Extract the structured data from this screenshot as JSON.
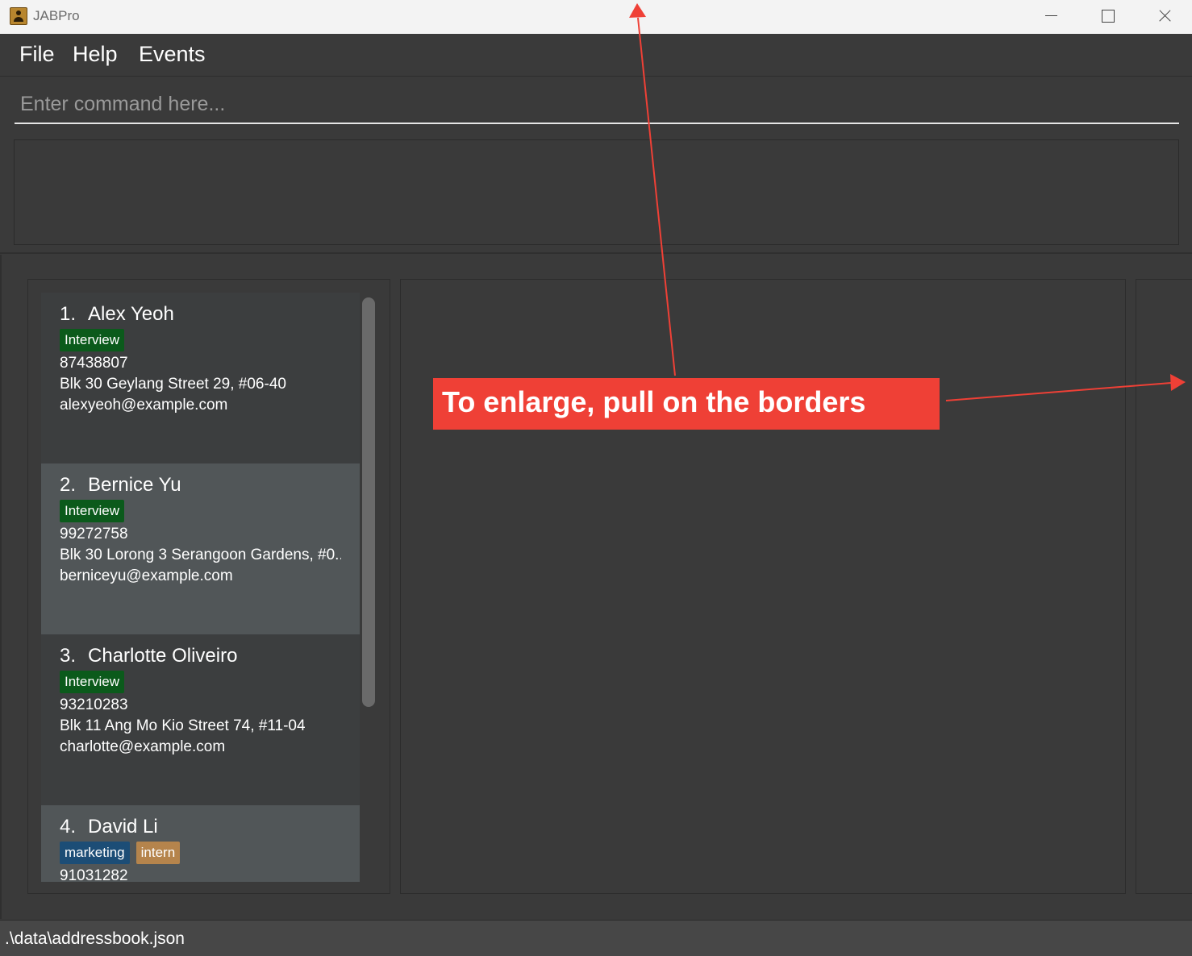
{
  "window": {
    "title": "JABPro",
    "controls": [
      "minimize",
      "maximize",
      "close"
    ]
  },
  "menu": {
    "items": [
      "File",
      "Help",
      "Events"
    ]
  },
  "command": {
    "placeholder": "Enter command here...",
    "value": ""
  },
  "result": {
    "text": ""
  },
  "persons": [
    {
      "index": "1.",
      "name": "Alex Yeoh",
      "tags": [
        {
          "label": "Interview",
          "color": "#0b5a1b"
        }
      ],
      "phone": "87438807",
      "address": "Blk 30 Geylang Street 29, #06-40",
      "email": "alexyeoh@example.com"
    },
    {
      "index": "2.",
      "name": "Bernice Yu",
      "tags": [
        {
          "label": "Interview",
          "color": "#0b5a1b"
        }
      ],
      "phone": "99272758",
      "address": "Blk 30 Lorong 3 Serangoon Gardens, #0...",
      "email": "berniceyu@example.com"
    },
    {
      "index": "3.",
      "name": "Charlotte Oliveiro",
      "tags": [
        {
          "label": "Interview",
          "color": "#0b5a1b"
        }
      ],
      "phone": "93210283",
      "address": "Blk 11 Ang Mo Kio Street 74, #11-04",
      "email": "charlotte@example.com"
    },
    {
      "index": "4.",
      "name": "David Li",
      "tags": [
        {
          "label": "marketing",
          "color": "#1c4d76"
        },
        {
          "label": "intern",
          "color": "#b5844c"
        }
      ],
      "phone": "91031282"
    }
  ],
  "status": {
    "file_path": ".\\data\\addressbook.json"
  },
  "annotation": {
    "text": "To enlarge, pull on the borders",
    "color": "#ef4036"
  },
  "colors": {
    "background": "#3a3a3a",
    "titlebar": "#f3f3f3",
    "card_selected": "#515658",
    "card_default": "#3c3e3f"
  }
}
